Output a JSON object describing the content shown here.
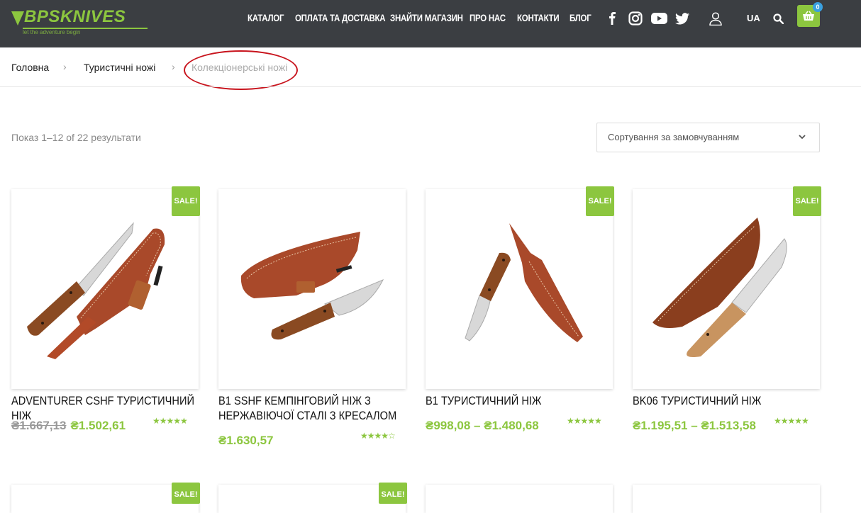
{
  "header": {
    "logo_text": "BPSKNIVES",
    "logo_tagline": "let the adventure begin",
    "nav": [
      "КАТАЛОГ",
      "ОПЛАТА ТА ДОСТАВКА",
      "ЗНАЙТИ МАГАЗИН",
      "ПРО НАС",
      "КОНТАКТИ",
      "БЛОГ"
    ],
    "social_icons": [
      "facebook-icon",
      "instagram-icon",
      "youtube-icon",
      "twitter-icon"
    ],
    "language": "UA",
    "cart_count": "0",
    "accent_color": "#8cc63f",
    "header_bg": "#3b3e42"
  },
  "breadcrumbs": {
    "home": "Головна",
    "category": "Туристичні ножі",
    "current": "Колекціонерські ножі"
  },
  "listing": {
    "result_count": "Показ 1–12 of 22 результати",
    "sort_label": "Сортування за замовчуванням"
  },
  "products": [
    {
      "sale_badge": "SALE!",
      "title": "ADVENTURER CSHF ТУРИСТИЧНИЙ НІЖ",
      "old_price": "₴1.667,13",
      "price": "₴1.502,61",
      "rating": 5
    },
    {
      "sale_badge": "",
      "title": "B1 SSHF КЕМПІНГОВИЙ НІЖ З НЕРЖАВІЮЧОЇ СТАЛІ З КРЕСАЛОМ",
      "old_price": "",
      "price": "₴1.630,57",
      "rating": 4
    },
    {
      "sale_badge": "SALE!",
      "title": "B1 ТУРИСТИЧНИЙ НІЖ",
      "old_price": "",
      "price": "₴998,08 – ₴1.480,68",
      "rating": 5
    },
    {
      "sale_badge": "SALE!",
      "title": "BK06 ТУРИСТИЧНИЙ НІЖ",
      "old_price": "",
      "price": "₴1.195,51 – ₴1.513,58",
      "rating": 5
    }
  ],
  "row2_badges": [
    "SALE!",
    "SALE!",
    "",
    ""
  ]
}
